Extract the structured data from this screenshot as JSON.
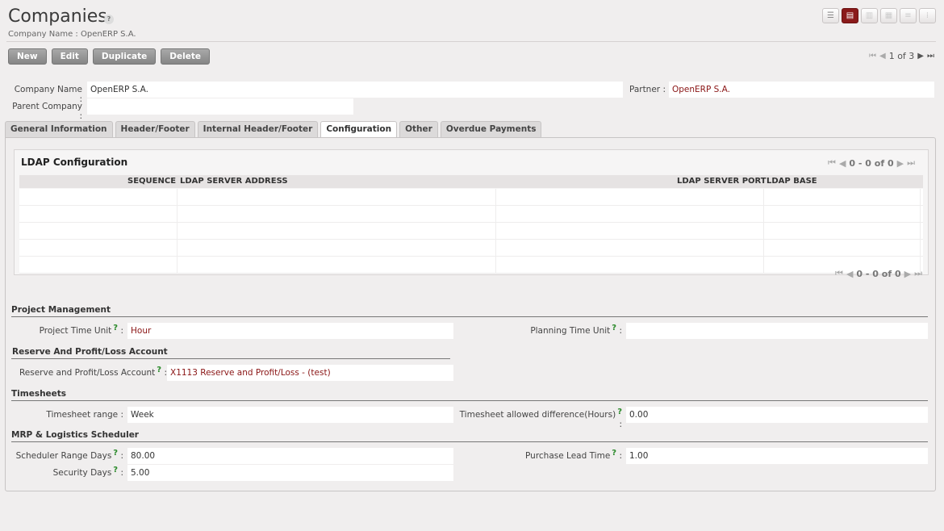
{
  "header": {
    "title": "Companies",
    "help": "?",
    "breadcrumb": "Company Name : OpenERP S.A."
  },
  "view_switch": [
    "list-view-icon",
    "form-view-icon",
    "graph-view-icon",
    "calendar-view-icon",
    "gantt-view-icon",
    "kanban-view-icon"
  ],
  "toolbar": {
    "new_label": "New",
    "edit_label": "Edit",
    "duplicate_label": "Duplicate",
    "delete_label": "Delete"
  },
  "pager": {
    "text": "1 of 3"
  },
  "form": {
    "company_name_label": "Company Name :",
    "company_name_value": "OpenERP S.A.",
    "partner_label": "Partner :",
    "partner_value": "OpenERP S.A.",
    "parent_company_label": "Parent Company :",
    "parent_company_value": ""
  },
  "tabs": [
    {
      "label": "General Information",
      "active": false
    },
    {
      "label": "Header/Footer",
      "active": false
    },
    {
      "label": "Internal Header/Footer",
      "active": false
    },
    {
      "label": "Configuration",
      "active": true
    },
    {
      "label": "Other",
      "active": false
    },
    {
      "label": "Overdue Payments",
      "active": false
    }
  ],
  "ldap": {
    "title": "LDAP Configuration",
    "pager_text": "0 - 0 of 0",
    "columns": [
      "SEQUENCE",
      "LDAP SERVER ADDRESS",
      "LDAP SERVER PORT",
      "LDAP BASE"
    ]
  },
  "sections": {
    "project": {
      "title": "Project Management",
      "time_unit_label": "Project Time Unit",
      "time_unit_value": "Hour",
      "planning_unit_label": "Planning Time Unit",
      "planning_unit_value": ""
    },
    "reserve": {
      "title": "Reserve And Profit/Loss Account",
      "account_label": "Reserve and Profit/Loss Account",
      "account_value": "X1113 Reserve and Profit/Loss - (test)"
    },
    "timesheets": {
      "title": "Timesheets",
      "range_label": "Timesheet range :",
      "range_value": "Week",
      "diff_label": "Timesheet allowed difference(Hours)",
      "diff_value": "0.00"
    },
    "mrp": {
      "title": "MRP & Logistics Scheduler",
      "range_days_label": "Scheduler Range Days",
      "range_days_value": "80.00",
      "purchase_label": "Purchase Lead Time",
      "purchase_value": "1.00",
      "security_label": "Security Days",
      "security_value": "5.00"
    }
  },
  "colors": {
    "accent": "#8a1515",
    "button": "#8f8f8f",
    "help": "#2a8a2a"
  }
}
